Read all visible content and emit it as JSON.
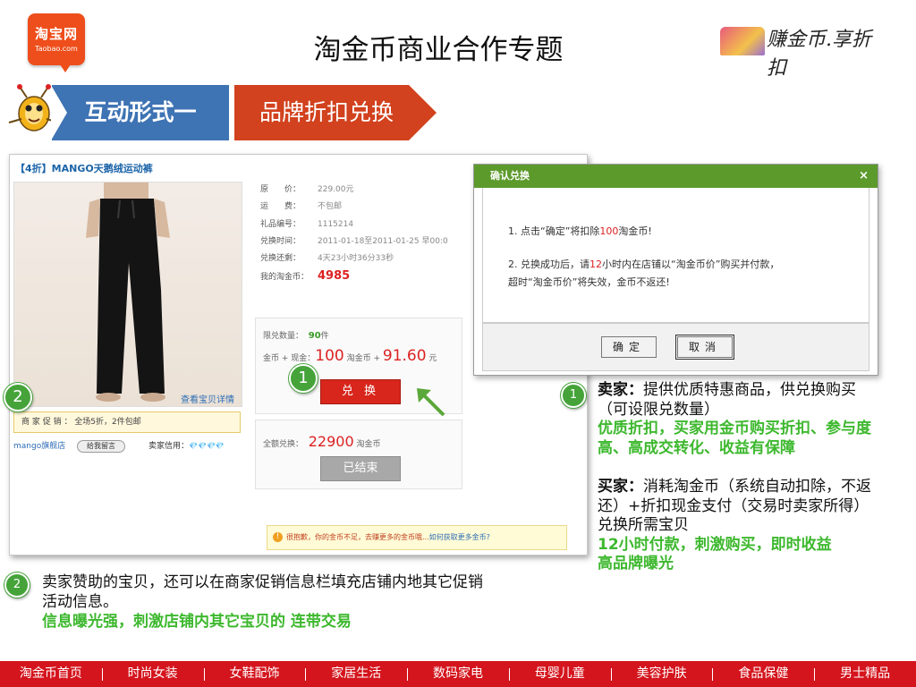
{
  "header": {
    "logo_line1": "淘宝网",
    "logo_line2": "Taobao.com",
    "title": "淘金币商业合作专题",
    "slogan": "赚金币.享折扣"
  },
  "ribbons": {
    "left": "互动形式一",
    "right": "品牌折扣兑换"
  },
  "product": {
    "title": "【4折】MANGO天鹅绒运动裤",
    "detail_link": "查看宝贝详情",
    "promo": "商 家 促 销 ： 全场5折，2件包邮",
    "shop": "mango旗舰店",
    "message_button": "给我留言",
    "credit_label": "卖家信用：",
    "credit_icons": "💎💎💎💎",
    "info": [
      {
        "k": "原　　价：",
        "v": "229.00元"
      },
      {
        "k": "运　　费：",
        "v": "不包邮"
      },
      {
        "k": "礼品编号：",
        "v": "1115214"
      },
      {
        "k": "兑换时间：",
        "v": "2011-01-18至2011-01-25 早00:0"
      },
      {
        "k": "兑换还剩：",
        "v": "4天23小时36分33秒"
      }
    ],
    "my_coins_label": "我的淘金币：",
    "my_coins": "4985",
    "limit_label": "限兑数量：",
    "limit_value": "90",
    "limit_unit": "件",
    "mix_label": "金币 + 现金：",
    "mix_coins": "100",
    "mix_coin_unit": "淘金币 +",
    "mix_cash": "91.60",
    "mix_cash_unit": "元",
    "exchange_button": "兑 换",
    "full_label": "全额兑换：",
    "full_coins": "22900",
    "full_unit": "淘金币",
    "ended_button": "已结束",
    "warning": "很抱歉，你的金币不足，去赚更多的金币哦...",
    "warning_link": "如何获取更多金币?"
  },
  "dialog": {
    "title": "确认兑换",
    "close": "×",
    "line1_a": "1. 点击“确定”将扣除",
    "line1_num": "100",
    "line1_b": "淘金币!",
    "line2_a": "2. 兑换成功后，请",
    "line2_num": "12",
    "line2_b": "小时内在店铺以“淘金币价”购买并付款，",
    "line3": "超时“淘金币价”将失效，金币不返还!",
    "ok": "确定",
    "cancel": "取消"
  },
  "badges": {
    "one": "1",
    "two": "2"
  },
  "seller": {
    "label": "卖家：",
    "text": "提供优质特惠商品，供兑换购买（可设限兑数量）",
    "highlight": "优质折扣，买家用金币购买折扣、参与度高、高成交转化、收益有保障"
  },
  "buyer": {
    "label": "买家：",
    "text": "消耗淘金币（系统自动扣除，不返还）+折扣现金支付（交易时卖家所得） 兑换所需宝贝",
    "highlight1": "12小时付款，刺激购买，即时收益",
    "highlight2": "高品牌曝光"
  },
  "bottom_note": {
    "text": "卖家赞助的宝贝，还可以在商家促销信息栏填充店铺内地其它促销活动信息。",
    "highlight": "信息曝光强，刺激店铺内其它宝贝的 连带交易"
  },
  "nav": [
    "淘金币首页",
    "时尚女装",
    "女鞋配饰",
    "家居生活",
    "数码家电",
    "母婴儿童",
    "美容护肤",
    "食品保健",
    "男士精品"
  ],
  "colors": {
    "nav_red": "#d4151d",
    "ribbon_blue": "#3e73b4",
    "ribbon_red": "#d2421e",
    "highlight_green": "#3db82e",
    "badge_green": "#45a33a"
  }
}
